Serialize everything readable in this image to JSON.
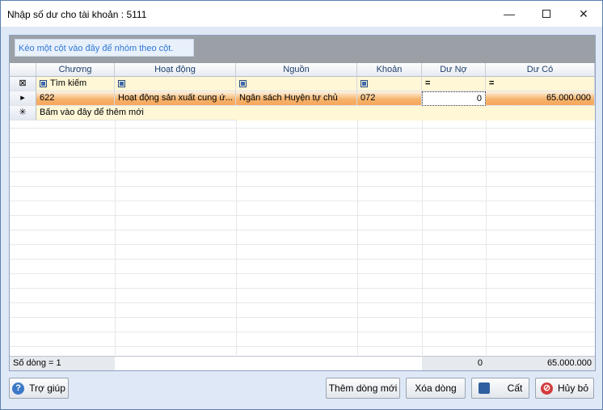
{
  "window": {
    "title": "Nhập số dư cho tài khoản : 5111"
  },
  "group_panel": {
    "hint": "Kéo một cột vào đây để nhóm theo cột."
  },
  "columns": [
    "Chương",
    "Hoạt động",
    "Nguồn",
    "Khoản",
    "Dư Nợ",
    "Dư Có"
  ],
  "filter": {
    "search_label": "Tìm kiếm",
    "eq_symbol": "="
  },
  "rows": [
    {
      "chuong": "622",
      "hoat_dong": "Hoạt động sản xuất cung ứ...",
      "nguon": "Ngân sách Huyện tự chủ",
      "khoan": "072",
      "du_no": "0",
      "du_co": "65.000.000"
    }
  ],
  "new_row": {
    "label": "Bấm vào đây để thêm mới"
  },
  "footer": {
    "row_count": "Số dòng = 1",
    "total_no": "0",
    "total_co": "65.000.000"
  },
  "buttons": {
    "help": "Trợ giúp",
    "add_row": "Thêm dòng mới",
    "delete_row": "Xóa dòng",
    "save": "Cất",
    "cancel": "Hủy bỏ"
  },
  "colors": {
    "selected_row": "#f9a55a",
    "filter_row": "#fff7d6",
    "group_panel": "#9aa0a6"
  }
}
